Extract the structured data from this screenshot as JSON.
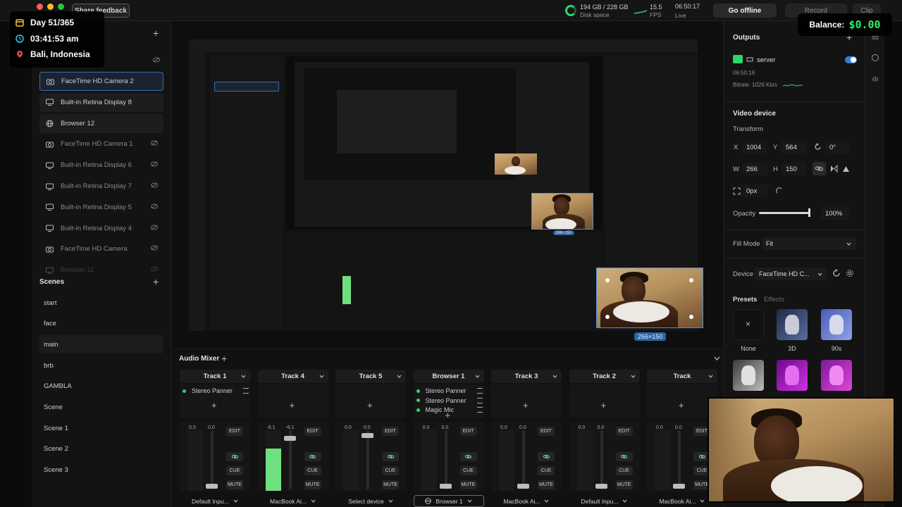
{
  "topbar": {
    "share_feedback": "Share feedback",
    "disk_value": "194 GB / 228 GB",
    "disk_label": "Disk space",
    "fps_value": "15.5",
    "fps_label": "FPS",
    "live_time": "06:50:17",
    "live_label": "Live",
    "go_offline": "Go offline",
    "record": "Record",
    "clip": "Clip"
  },
  "overlay": {
    "day": "Day 51/365",
    "time": "03:41:53 am",
    "location": "Bali, Indonesia",
    "balance_label": "Balance:",
    "balance_value": "$0.00"
  },
  "layers": {
    "items": [
      {
        "label": "FaceTime HD Camera 2",
        "icon": "camera-icon"
      },
      {
        "label": "Built-in Retina Display 8",
        "icon": "monitor-icon"
      },
      {
        "label": "Browser 12",
        "icon": "globe-icon"
      },
      {
        "label": "FaceTime HD Camera 1",
        "icon": "camera-icon"
      },
      {
        "label": "Built-in Retina Display 6",
        "icon": "monitor-icon"
      },
      {
        "label": "Built-in Retina Display 7",
        "icon": "monitor-icon"
      },
      {
        "label": "Built-in Retina Display 5",
        "icon": "monitor-icon"
      },
      {
        "label": "Built-in Retina Display 4",
        "icon": "monitor-icon"
      },
      {
        "label": "FaceTime HD Camera",
        "icon": "camera-icon"
      },
      {
        "label": "Browser 11",
        "icon": "monitor-icon"
      }
    ]
  },
  "scenes": {
    "title": "Scenes",
    "items": [
      "start",
      "face",
      "main",
      "brb",
      "GAMBLA",
      "Scene",
      "Scene 1",
      "Scene 2",
      "Scene 3"
    ],
    "selected": "main"
  },
  "preview": {
    "size_tag": "266×150"
  },
  "mixer": {
    "title": "Audio Mixer",
    "tracks": [
      {
        "name": "Track 1",
        "fx": [
          "Stereo Panner"
        ],
        "vol": "0.0",
        "level": 0,
        "knob": 0.95,
        "device": "Default Inpu..."
      },
      {
        "name": "Track 4",
        "fx": [],
        "vol": "-6.1",
        "vol2": "-6.1",
        "level": 0.7,
        "knob": 0.1,
        "device": "MacBook Ai..."
      },
      {
        "name": "Track 5",
        "fx": [],
        "vol": "0.0",
        "level": 0,
        "knob": 0.05,
        "device": "Select device"
      },
      {
        "name": "Browser 1",
        "fx": [
          "Stereo Panner",
          "Stereo Panner",
          "Magic Mic"
        ],
        "vol": "0.0",
        "level": 0,
        "knob": 0.95,
        "device": "Browser 1"
      },
      {
        "name": "Track 3",
        "fx": [],
        "vol": "0.0",
        "level": 0,
        "knob": 0.95,
        "device": "MacBook Ai..."
      },
      {
        "name": "Track 2",
        "fx": [],
        "vol": "0.0",
        "level": 0,
        "knob": 0.95,
        "device": "Default Inpu..."
      },
      {
        "name": "Track",
        "fx": [],
        "vol": "0.0",
        "level": 0,
        "knob": 0.95,
        "device": "MacBook Ai..."
      }
    ],
    "btn_edit": "EDIT",
    "btn_cue": "CUE",
    "btn_mute": "MUTE"
  },
  "outputs": {
    "title": "Outputs",
    "server_name": "server",
    "server_time": "06:50:16",
    "bitrate_label": "Bitrate",
    "bitrate_value": "1026 Kb/s"
  },
  "video_device": {
    "title": "Video device",
    "transform_label": "Transform",
    "x_label": "X",
    "x_value": "1004",
    "y_label": "Y",
    "y_value": "564",
    "rotation_value": "0°",
    "w_label": "W",
    "w_value": "266",
    "h_label": "H",
    "h_value": "150",
    "radius_value": "0px",
    "opacity_label": "Opacity",
    "opacity_value": "100%",
    "opacity_level": 1.0,
    "fill_mode_label": "Fill Mode",
    "fill_mode_value": "Fit",
    "device_label": "Device",
    "device_value": "FaceTime HD C...",
    "presets_tab": "Presets",
    "effects_tab": "Effects",
    "presets": [
      "None",
      "3D",
      "90s"
    ]
  },
  "colors": {
    "accent_blue": "#3d7bd9",
    "live_green": "#2fd46a",
    "balance_green": "#2cf262"
  }
}
